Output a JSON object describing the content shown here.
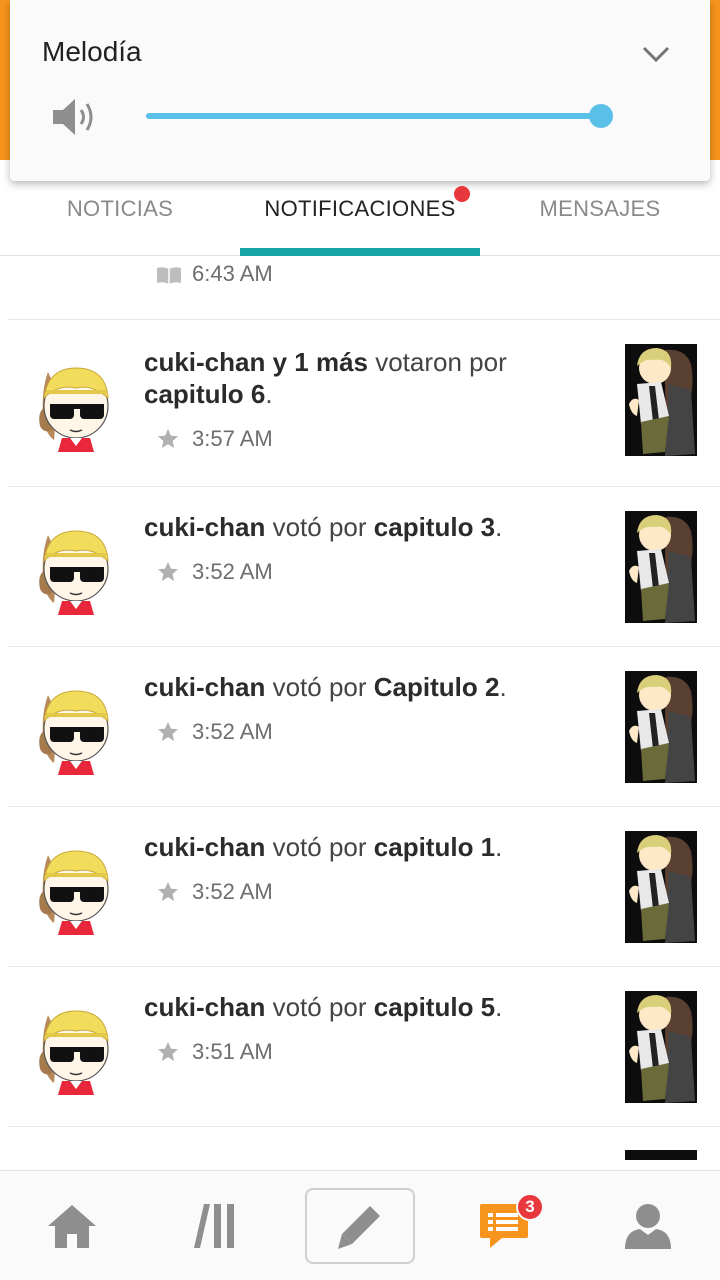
{
  "volume": {
    "title": "Melodía",
    "level": 0.98,
    "speaker_icon": "volume-icon",
    "collapse_icon": "chevron-down-icon",
    "color": "#5bc0e8"
  },
  "tabs": [
    {
      "label": "NOTICIAS",
      "active": false
    },
    {
      "label": "NOTIFICACIONES",
      "active": true,
      "has_dot": true
    },
    {
      "label": "MENSAJES",
      "active": false
    }
  ],
  "partial_row": {
    "time": "6:43 AM",
    "icon": "book-icon"
  },
  "notifications": [
    {
      "user": "cuki-chan y 1 más",
      "action": " votaron por ",
      "story": "capitulo 6",
      "end": ".",
      "time": "3:57 AM"
    },
    {
      "user": "cuki-chan",
      "action": " votó por ",
      "story": "capitulo 3",
      "end": ".",
      "time": "3:52 AM"
    },
    {
      "user": "cuki-chan",
      "action": " votó por ",
      "story": "Capitulo 2",
      "end": ".",
      "time": "3:52 AM"
    },
    {
      "user": "cuki-chan",
      "action": " votó por ",
      "story": "capitulo 1",
      "end": ".",
      "time": "3:52 AM"
    },
    {
      "user": "cuki-chan",
      "action": " votó por ",
      "story": "capitulo 5",
      "end": ".",
      "time": "3:51 AM"
    }
  ],
  "bottom_nav": {
    "items": [
      "home-icon",
      "library-icon",
      "write-icon",
      "notifications-icon",
      "profile-icon"
    ],
    "badge": "3",
    "accent": "#f7941d",
    "badge_color": "#e8383d"
  },
  "colors": {
    "app_bar": "#f7941d",
    "tab_indicator": "#17a6a6"
  }
}
